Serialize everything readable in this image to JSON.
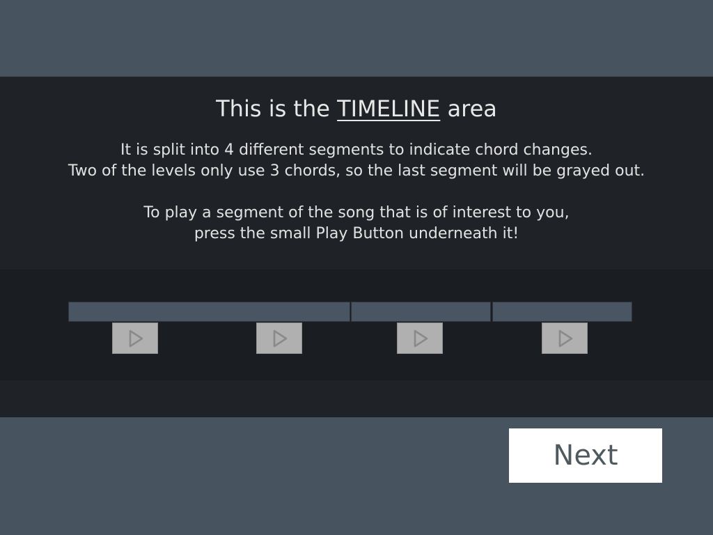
{
  "tutorial": {
    "title_prefix": "This is the ",
    "title_keyword": "TIMELINE",
    "title_suffix": " area",
    "paragraph1_line1": "It is split into 4 different segments to indicate chord changes.",
    "paragraph1_line2": "Two of the levels only use 3 chords, so the last segment will be grayed out.",
    "paragraph2_line1": "To play a segment of the song that is of interest to you,",
    "paragraph2_line2": "press the small Play Button underneath it!"
  },
  "timeline": {
    "segment_count": 4,
    "play_icon": "play-triangle-icon"
  },
  "navigation": {
    "next_label": "Next"
  },
  "colors": {
    "background": "#47535f",
    "overlay": "#1f2226",
    "timeline_bg": "#1a1d21",
    "segment": "#4a5564",
    "play_button": "#b0b0b0",
    "next_button_bg": "#ffffff",
    "next_button_text": "#4f5a5e"
  }
}
